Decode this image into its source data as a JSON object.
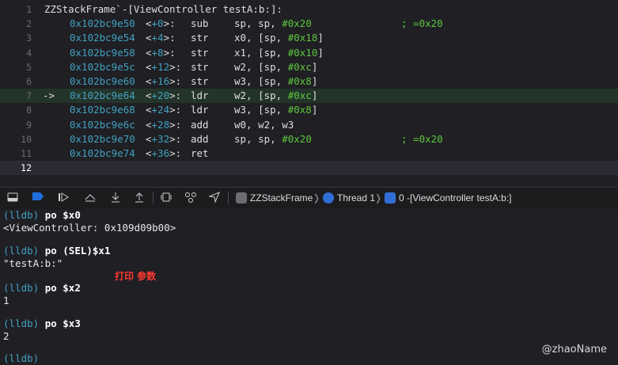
{
  "editor": {
    "lines": [
      {
        "num": "1",
        "text": "ZZStackFrame`-[ViewController testA:b:]:"
      },
      {
        "num": "2",
        "addr": "0x102bc9e50",
        "off": "+0",
        "mnem": "sub",
        "ops": "sp, sp, ",
        "imm": "#0x20",
        "cmt": "; =0x20"
      },
      {
        "num": "3",
        "addr": "0x102bc9e54",
        "off": "+4",
        "mnem": "str",
        "ops": "x0, [sp, ",
        "imm": "#0x18",
        "tail": "]"
      },
      {
        "num": "4",
        "addr": "0x102bc9e58",
        "off": "+8",
        "mnem": "str",
        "ops": "x1, [sp, ",
        "imm": "#0x10",
        "tail": "]"
      },
      {
        "num": "5",
        "addr": "0x102bc9e5c",
        "off": "+12",
        "mnem": "str",
        "ops": "w2, [sp, ",
        "imm": "#0xc",
        "tail": "]"
      },
      {
        "num": "6",
        "addr": "0x102bc9e60",
        "off": "+16",
        "mnem": "str",
        "ops": "w3, [sp, ",
        "imm": "#0x8",
        "tail": "]"
      },
      {
        "num": "7",
        "arrow": "->",
        "addr": "0x102bc9e64",
        "off": "+20",
        "mnem": "ldr",
        "ops": "w2, [sp, ",
        "imm": "#0xc",
        "tail": "]"
      },
      {
        "num": "8",
        "addr": "0x102bc9e68",
        "off": "+24",
        "mnem": "ldr",
        "ops": "w3, [sp, ",
        "imm": "#0x8",
        "tail": "]"
      },
      {
        "num": "9",
        "addr": "0x102bc9e6c",
        "off": "+28",
        "mnem": "add",
        "ops": "w0, w2, w3"
      },
      {
        "num": "10",
        "addr": "0x102bc9e70",
        "off": "+32",
        "mnem": "add",
        "ops": "sp, sp, ",
        "imm": "#0x20",
        "cmt": "; =0x20"
      },
      {
        "num": "11",
        "addr": "0x102bc9e74",
        "off": "+36",
        "mnem": "ret",
        "ops": ""
      },
      {
        "num": "12"
      }
    ]
  },
  "toolbar": {
    "icons": [
      "hide-console-icon",
      "breakpoint-toggle-icon",
      "continue-icon",
      "step-over-icon",
      "step-into-icon",
      "step-out-icon",
      "view-hierarchy-icon",
      "memory-graph-icon",
      "location-icon"
    ],
    "breadcrumb": {
      "app": "ZZStackFrame",
      "thread": "Thread 1",
      "frame": "0 -[ViewController testA:b:]"
    }
  },
  "console": {
    "prompt": "(lldb)",
    "entries": [
      {
        "cmd": "po $x0",
        "out": "<ViewController: 0x109d09b00>"
      },
      {
        "cmd": "po (SEL)$x1",
        "out": "\"testA:b:\""
      },
      {
        "cmd": "po $x2",
        "out": "1"
      },
      {
        "cmd": "po $x3",
        "out": "2"
      }
    ],
    "annotation": "打印 参数",
    "watermark": "@zhaoName"
  },
  "colors": {
    "accent": "#41a1c0",
    "immediate": "#5fc63d",
    "annotation": "#ff3b30",
    "breakpoint": "#1f6fe0"
  }
}
